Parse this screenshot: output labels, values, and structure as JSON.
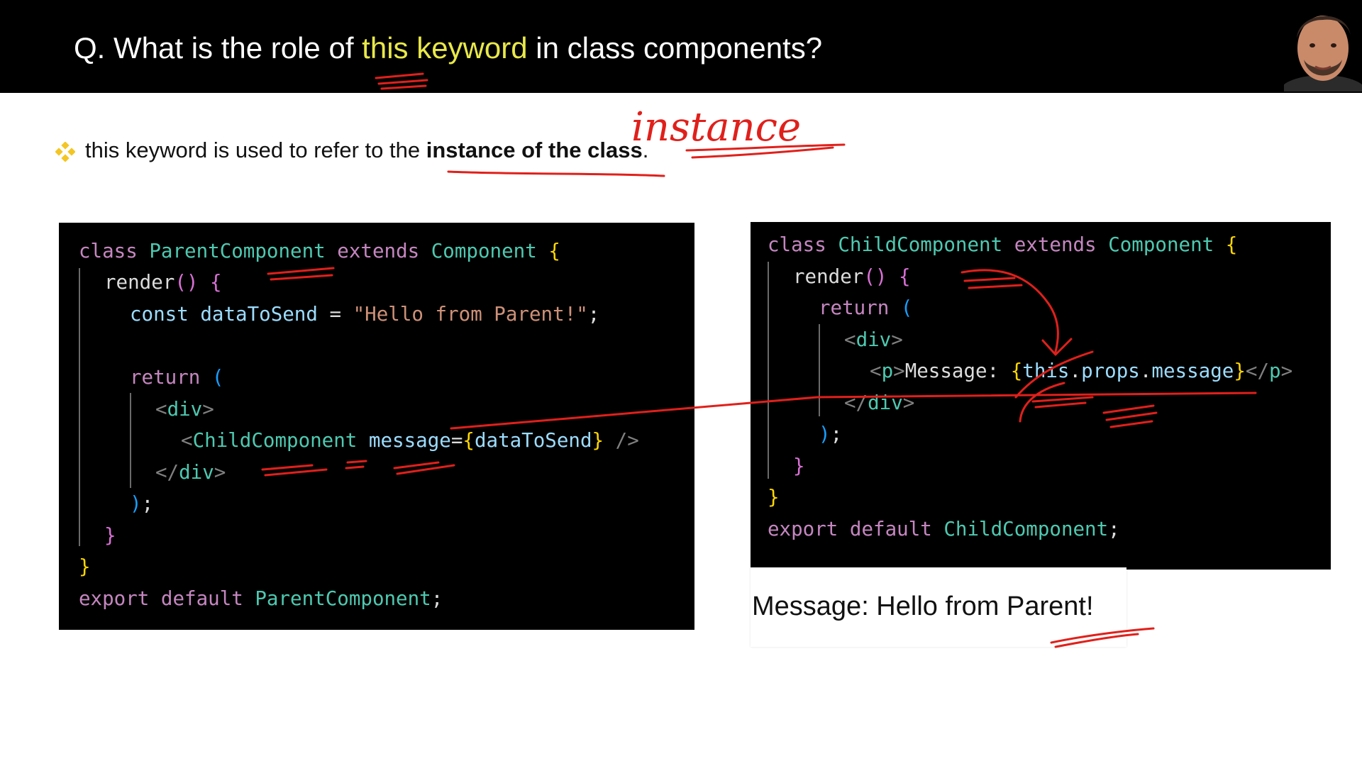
{
  "slide": {
    "title": {
      "prefix": "Q. What is the role of ",
      "highlight": "this keyword",
      "suffix": " in class components?"
    },
    "bullet": {
      "prefix": "this keyword is used to refer to the ",
      "bold": "instance of the class",
      "suffix": "."
    },
    "handwritten_note": "instance",
    "accent_color": "#e8e84a",
    "ink_color": "#e0201b",
    "bullet_icon": "diamond-bullet-icon",
    "presenter": "presenter-avatar"
  },
  "parent_code": {
    "l1": {
      "t1": "class",
      "t2": "ParentComponent",
      "t3": "extends",
      "t4": "Component",
      "t5": "{"
    },
    "l2": {
      "t1": "render",
      "t2": "()",
      "t3": "{"
    },
    "l3": {
      "t1": "const",
      "t2": "dataToSend",
      "t3": "=",
      "t4": "\"Hello from Parent!\"",
      "t5": ";"
    },
    "l5": {
      "t1": "return",
      "t2": "("
    },
    "l6": {
      "t1": "<",
      "t2": "div",
      "t3": ">"
    },
    "l7": {
      "t1": "<",
      "t2": "ChildComponent",
      "t3": "message",
      "t4": "=",
      "t5": "{",
      "t6": "dataToSend",
      "t7": "}",
      "t8": "/>"
    },
    "l8": {
      "t1": "</",
      "t2": "div",
      "t3": ">"
    },
    "l9": {
      "t1": ")",
      "t2": ";"
    },
    "l10": {
      "t1": "}"
    },
    "l11": {
      "t1": "}"
    },
    "l12": {
      "t1": "export",
      "t2": "default",
      "t3": "ParentComponent",
      "t4": ";"
    }
  },
  "child_code": {
    "l1": {
      "t1": "class",
      "t2": "ChildComponent",
      "t3": "extends",
      "t4": "Component",
      "t5": "{"
    },
    "l2": {
      "t1": "render",
      "t2": "()",
      "t3": "{"
    },
    "l3": {
      "t1": "return",
      "t2": "("
    },
    "l4": {
      "t1": "<",
      "t2": "div",
      "t3": ">"
    },
    "l5": {
      "t1": "<",
      "t2": "p",
      "t3": ">",
      "t4": "Message: ",
      "t5": "{",
      "t6": "this",
      "t7": ".",
      "t8": "props",
      "t9": ".",
      "t10": "message",
      "t11": "}",
      "t12": "</",
      "t13": "p",
      "t14": ">"
    },
    "l6": {
      "t1": "</",
      "t2": "div",
      "t3": ">"
    },
    "l7": {
      "t1": ")",
      "t2": ";"
    },
    "l8": {
      "t1": "}"
    },
    "l9": {
      "t1": "}"
    },
    "l10": {
      "t1": "export",
      "t2": "default",
      "t3": "ChildComponent",
      "t4": ";"
    }
  },
  "output": {
    "text": "Message: Hello from Parent!"
  }
}
